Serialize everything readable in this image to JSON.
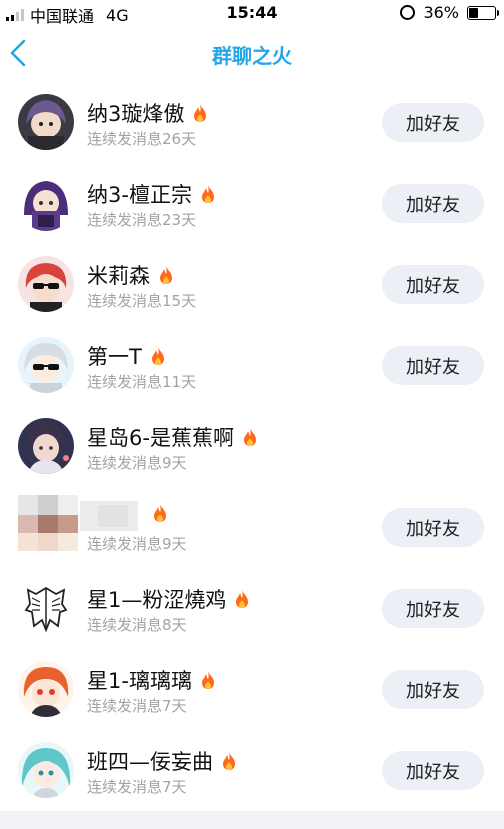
{
  "status_bar": {
    "carrier": "中国联通",
    "network": "4G",
    "time": "15:44",
    "battery": "36%",
    "battery_level": 0.36,
    "alarm_icon": "alarm-clock-icon"
  },
  "nav": {
    "title": "群聊之火",
    "back_icon": "chevron-left-icon",
    "accent_color": "#22a6e8"
  },
  "friends": [
    {
      "name": "纳3璇烽傲",
      "streak": "连续发消息26天",
      "button": "加好友",
      "show_button": true
    },
    {
      "name": "纳3-檀正宗",
      "streak": "连续发消息23天",
      "button": "加好友",
      "show_button": true
    },
    {
      "name": "米莉森",
      "streak": "连续发消息15天",
      "button": "加好友",
      "show_button": true
    },
    {
      "name": "第一T",
      "streak": "连续发消息11天",
      "button": "加好友",
      "show_button": true
    },
    {
      "name": "星岛6-是蕉蕉啊",
      "streak": "连续发消息9天",
      "button": "",
      "show_button": false
    },
    {
      "name": "",
      "streak": "连续发消息9天",
      "button": "加好友",
      "show_button": true,
      "blurred": true
    },
    {
      "name": "星1—粉涩燒鸡",
      "streak": "连续发消息8天",
      "button": "加好友",
      "show_button": true
    },
    {
      "name": "星1-璃璃璃",
      "streak": "连续发消息7天",
      "button": "加好友",
      "show_button": true
    },
    {
      "name": "班四—佞妄曲",
      "streak": "连续发消息7天",
      "button": "加好友",
      "show_button": true
    }
  ],
  "fire_icon": "fire-icon",
  "colors": {
    "button_bg": "#eceff5",
    "streak_text": "#a3a3a3",
    "fire": "#ff6a1a"
  }
}
